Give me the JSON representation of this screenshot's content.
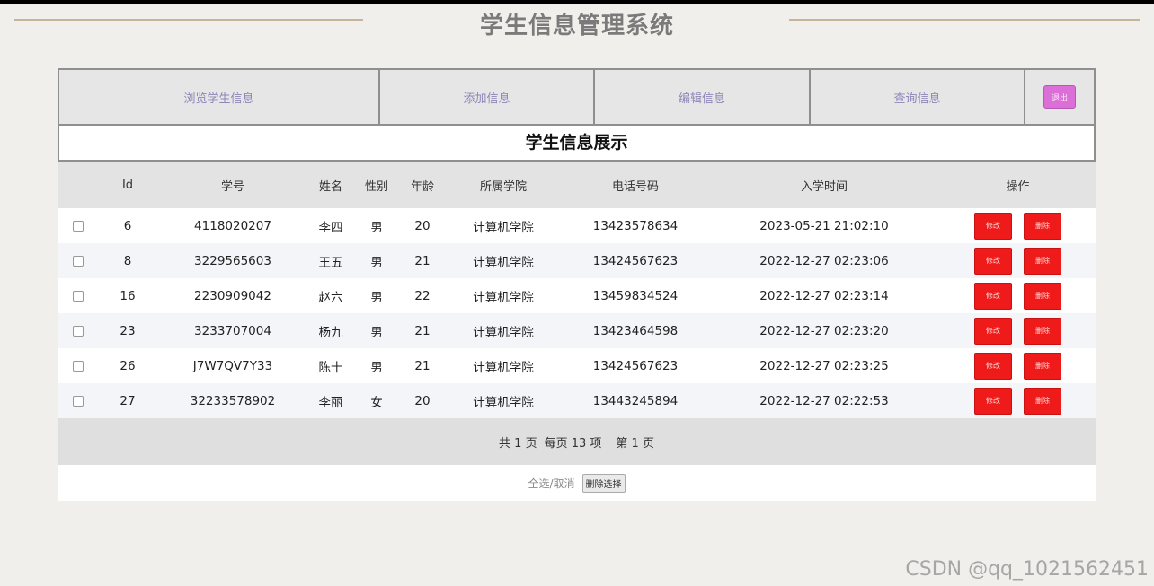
{
  "app": {
    "title": "学生信息管理系统"
  },
  "nav": {
    "items": [
      {
        "label": "浏览学生信息"
      },
      {
        "label": "添加信息"
      },
      {
        "label": "编辑信息"
      },
      {
        "label": "查询信息"
      }
    ],
    "logout_label": "退出"
  },
  "section": {
    "title": "学生信息展示"
  },
  "table": {
    "headers": [
      "Id",
      "学号",
      "姓名",
      "性别",
      "年龄",
      "所属学院",
      "电话号码",
      "入学时间",
      "操作"
    ],
    "rows": [
      {
        "id": "6",
        "student_no": "4118020207",
        "name": "李四",
        "gender": "男",
        "age": "20",
        "college": "计算机学院",
        "phone": "13423578634",
        "enroll_time": "2023-05-21 21:02:10"
      },
      {
        "id": "8",
        "student_no": "3229565603",
        "name": "王五",
        "gender": "男",
        "age": "21",
        "college": "计算机学院",
        "phone": "13424567623",
        "enroll_time": "2022-12-27 02:23:06"
      },
      {
        "id": "16",
        "student_no": "2230909042",
        "name": "赵六",
        "gender": "男",
        "age": "22",
        "college": "计算机学院",
        "phone": "13459834524",
        "enroll_time": "2022-12-27 02:23:14"
      },
      {
        "id": "23",
        "student_no": "3233707004",
        "name": "杨九",
        "gender": "男",
        "age": "21",
        "college": "计算机学院",
        "phone": "13423464598",
        "enroll_time": "2022-12-27 02:23:20"
      },
      {
        "id": "26",
        "student_no": "J7W7QV7Y33",
        "name": "陈十",
        "gender": "男",
        "age": "21",
        "college": "计算机学院",
        "phone": "13424567623",
        "enroll_time": "2022-12-27 02:23:25"
      },
      {
        "id": "27",
        "student_no": "32233578902",
        "name": "李丽",
        "gender": "女",
        "age": "20",
        "college": "计算机学院",
        "phone": "13443245894",
        "enroll_time": "2022-12-27 02:22:53"
      }
    ],
    "edit_label": "修改",
    "delete_label": "删除"
  },
  "pager": {
    "total_pages": "共 1 页",
    "per_page": "每页 13 项",
    "current_page": "第 1 页"
  },
  "bottom": {
    "select_all_label": "全选/取消",
    "delete_selected_label": "删除选择"
  },
  "watermark": "CSDN @qq_1021562451",
  "colors": {
    "delete_button": "#ef1a1a",
    "logout_button": "#db6fd7",
    "nav_text": "#8d86b8"
  }
}
